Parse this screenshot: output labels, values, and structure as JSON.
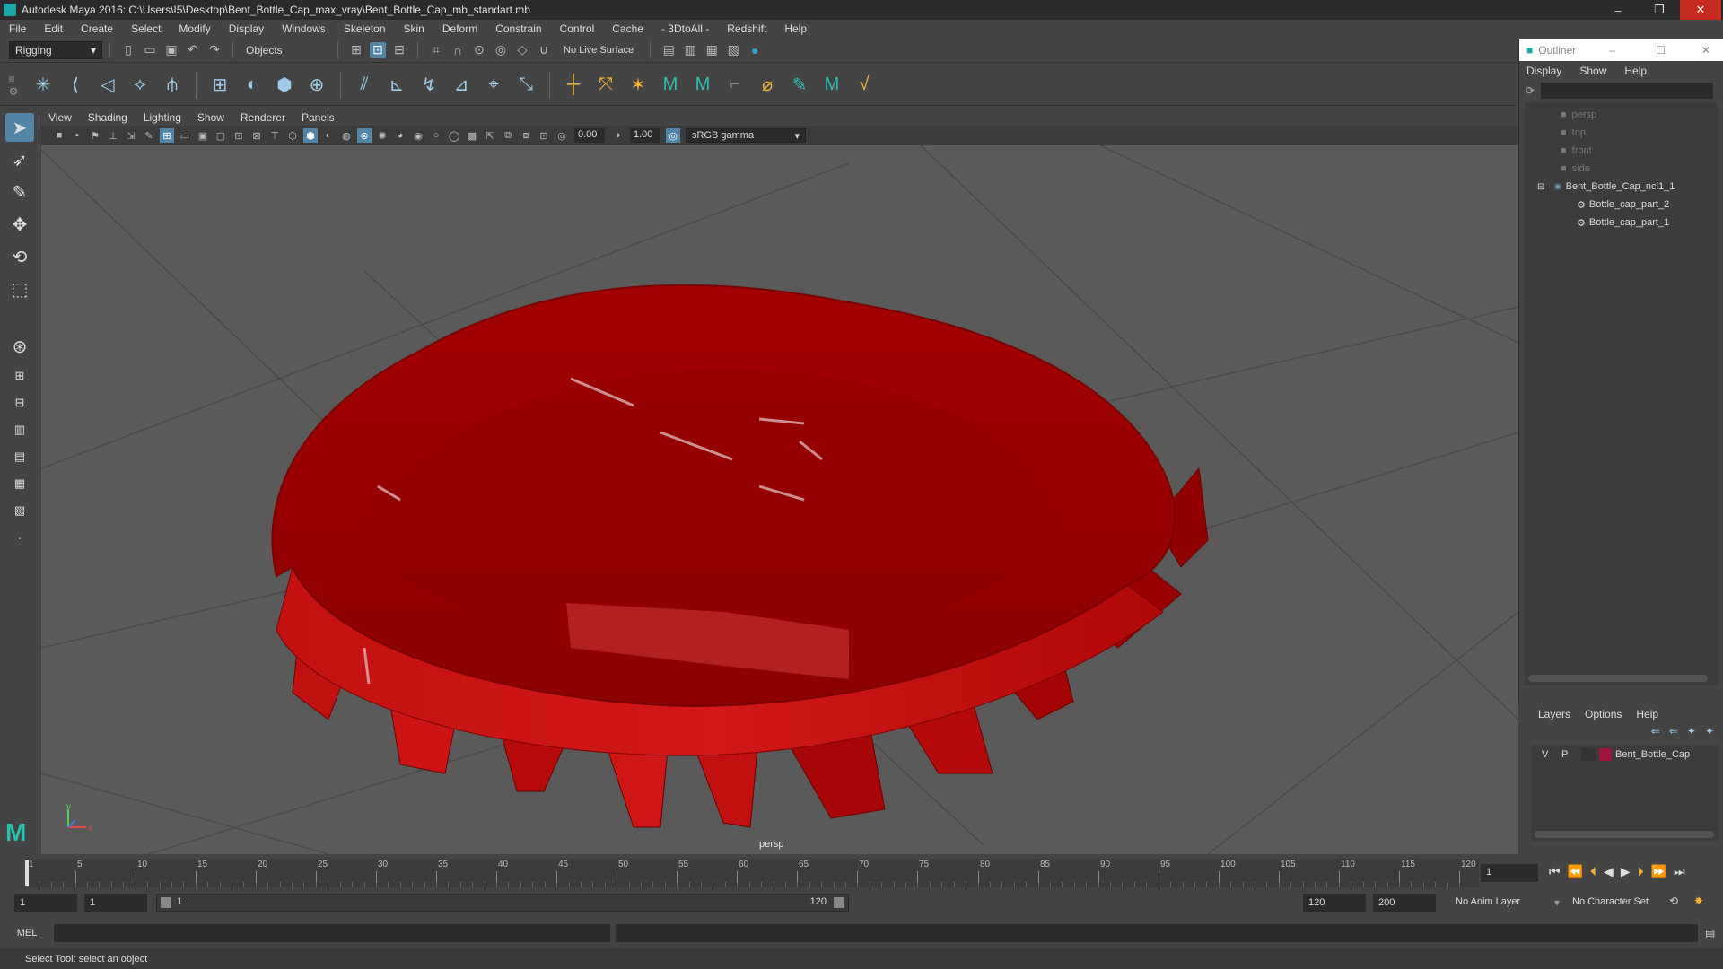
{
  "window": {
    "title": "Autodesk Maya 2016: C:\\Users\\I5\\Desktop\\Bent_Bottle_Cap_max_vray\\Bent_Bottle_Cap_mb_standart.mb",
    "minimize": "–",
    "restore": "❐",
    "close": "✕"
  },
  "menubar": [
    "File",
    "Edit",
    "Create",
    "Select",
    "Modify",
    "Display",
    "Windows",
    "Skeleton",
    "Skin",
    "Deform",
    "Constrain",
    "Control",
    "Cache",
    "- 3DtoAll -",
    "Redshift",
    "Help"
  ],
  "statusline": {
    "mode": "Rigging",
    "selection_mode": "Objects",
    "live_surface": "No Live Surface"
  },
  "viewport": {
    "menu": [
      "View",
      "Shading",
      "Lighting",
      "Show",
      "Renderer",
      "Panels"
    ],
    "near_value": "0.00",
    "far_value": "1.00",
    "color_space": "sRGB gamma",
    "camera_label": "persp",
    "axis_y": "y",
    "axis_x": "x"
  },
  "outliner": {
    "title": "Outliner",
    "menu": [
      "Display",
      "Show",
      "Help"
    ],
    "items": [
      {
        "label": "persp",
        "dim": true,
        "depth": 0
      },
      {
        "label": "top",
        "dim": true,
        "depth": 0
      },
      {
        "label": "front",
        "dim": true,
        "depth": 0
      },
      {
        "label": "side",
        "dim": true,
        "depth": 0
      },
      {
        "label": "Bent_Bottle_Cap_ncl1_1",
        "dim": false,
        "depth": 0
      },
      {
        "label": "Bottle_cap_part_2",
        "dim": false,
        "depth": 1
      },
      {
        "label": "Bottle_cap_part_1",
        "dim": false,
        "depth": 1
      }
    ]
  },
  "layers": {
    "menu": [
      "Layers",
      "Options",
      "Help"
    ],
    "row": {
      "v": "V",
      "p": "P",
      "name": "Bent_Bottle_Cap",
      "color": "#a0153e"
    }
  },
  "timeline": {
    "ticks": [
      "1",
      "5",
      "10",
      "15",
      "20",
      "25",
      "30",
      "35",
      "40",
      "45",
      "50",
      "55",
      "60",
      "65",
      "70",
      "75",
      "80",
      "85",
      "90",
      "95",
      "100",
      "105",
      "110",
      "115",
      "120"
    ],
    "current_frame": "1"
  },
  "range": {
    "start": "1",
    "playback_start": "1",
    "slider_start": "1",
    "slider_end": "120",
    "playback_end": "120",
    "end": "200",
    "anim_layer": "No Anim Layer",
    "char_set": "No Character Set"
  },
  "cmdline": {
    "lang": "MEL"
  },
  "helpline": {
    "text": "Select Tool: select an object"
  },
  "colors": {
    "accent": "#5285a6",
    "cap_red": "#b30000"
  }
}
